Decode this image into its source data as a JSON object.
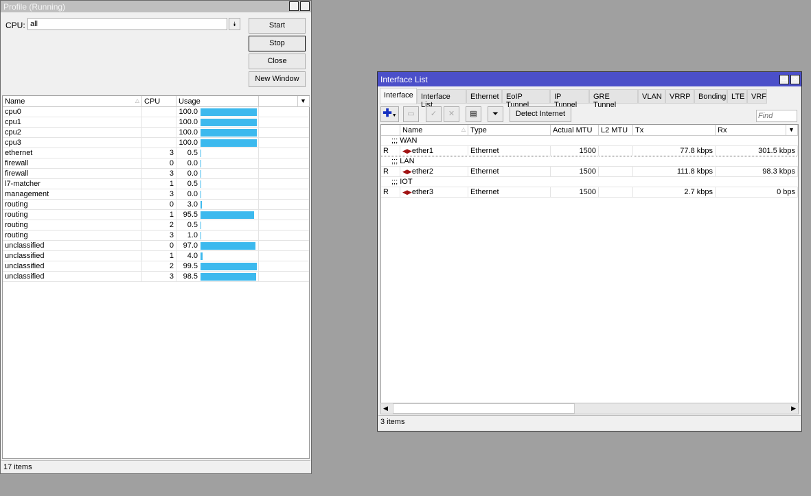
{
  "profile": {
    "title": "Profile (Running)",
    "cpu_label": "CPU:",
    "cpu_value": "all",
    "buttons": {
      "start": "Start",
      "stop": "Stop",
      "close": "Close",
      "new_window": "New Window"
    },
    "columns": [
      "Name",
      "CPU",
      "Usage"
    ],
    "rows": [
      {
        "name": "cpu0",
        "cpu": "",
        "usage": "100.0"
      },
      {
        "name": "cpu1",
        "cpu": "",
        "usage": "100.0"
      },
      {
        "name": "cpu2",
        "cpu": "",
        "usage": "100.0"
      },
      {
        "name": "cpu3",
        "cpu": "",
        "usage": "100.0"
      },
      {
        "name": "ethernet",
        "cpu": "3",
        "usage": "0.5"
      },
      {
        "name": "firewall",
        "cpu": "0",
        "usage": "0.0"
      },
      {
        "name": "firewall",
        "cpu": "3",
        "usage": "0.0"
      },
      {
        "name": "l7-matcher",
        "cpu": "1",
        "usage": "0.5"
      },
      {
        "name": "management",
        "cpu": "3",
        "usage": "0.0"
      },
      {
        "name": "routing",
        "cpu": "0",
        "usage": "3.0"
      },
      {
        "name": "routing",
        "cpu": "1",
        "usage": "95.5"
      },
      {
        "name": "routing",
        "cpu": "2",
        "usage": "0.5"
      },
      {
        "name": "routing",
        "cpu": "3",
        "usage": "1.0"
      },
      {
        "name": "unclassified",
        "cpu": "0",
        "usage": "97.0"
      },
      {
        "name": "unclassified",
        "cpu": "1",
        "usage": "4.0"
      },
      {
        "name": "unclassified",
        "cpu": "2",
        "usage": "99.5"
      },
      {
        "name": "unclassified",
        "cpu": "3",
        "usage": "98.5"
      }
    ],
    "status": "17 items",
    "bar_color": "#3cb9ee"
  },
  "iface": {
    "title": "Interface List",
    "title_color": "#4b4fc9",
    "tabs": [
      "Interface",
      "Interface List",
      "Ethernet",
      "EoIP Tunnel",
      "IP Tunnel",
      "GRE Tunnel",
      "VLAN",
      "VRRP",
      "Bonding",
      "LTE",
      "VRF"
    ],
    "detect": "Detect Internet",
    "find_placeholder": "Find",
    "columns": [
      "Name",
      "Type",
      "Actual MTU",
      "L2 MTU",
      "Tx",
      "Rx"
    ],
    "groups": [
      {
        "comment": ";;; WAN",
        "flag": "R",
        "name": "ether1",
        "type": "Ethernet",
        "mtu": "1500",
        "l2mtu": "",
        "tx": "77.8 kbps",
        "rx": "301.5 kbps"
      },
      {
        "comment": ";;; LAN",
        "flag": "R",
        "name": "ether2",
        "type": "Ethernet",
        "mtu": "1500",
        "l2mtu": "",
        "tx": "111.8 kbps",
        "rx": "98.3 kbps"
      },
      {
        "comment": ";;; IOT",
        "flag": "R",
        "name": "ether3",
        "type": "Ethernet",
        "mtu": "1500",
        "l2mtu": "",
        "tx": "2.7 kbps",
        "rx": "0 bps"
      }
    ],
    "status": "3 items"
  }
}
